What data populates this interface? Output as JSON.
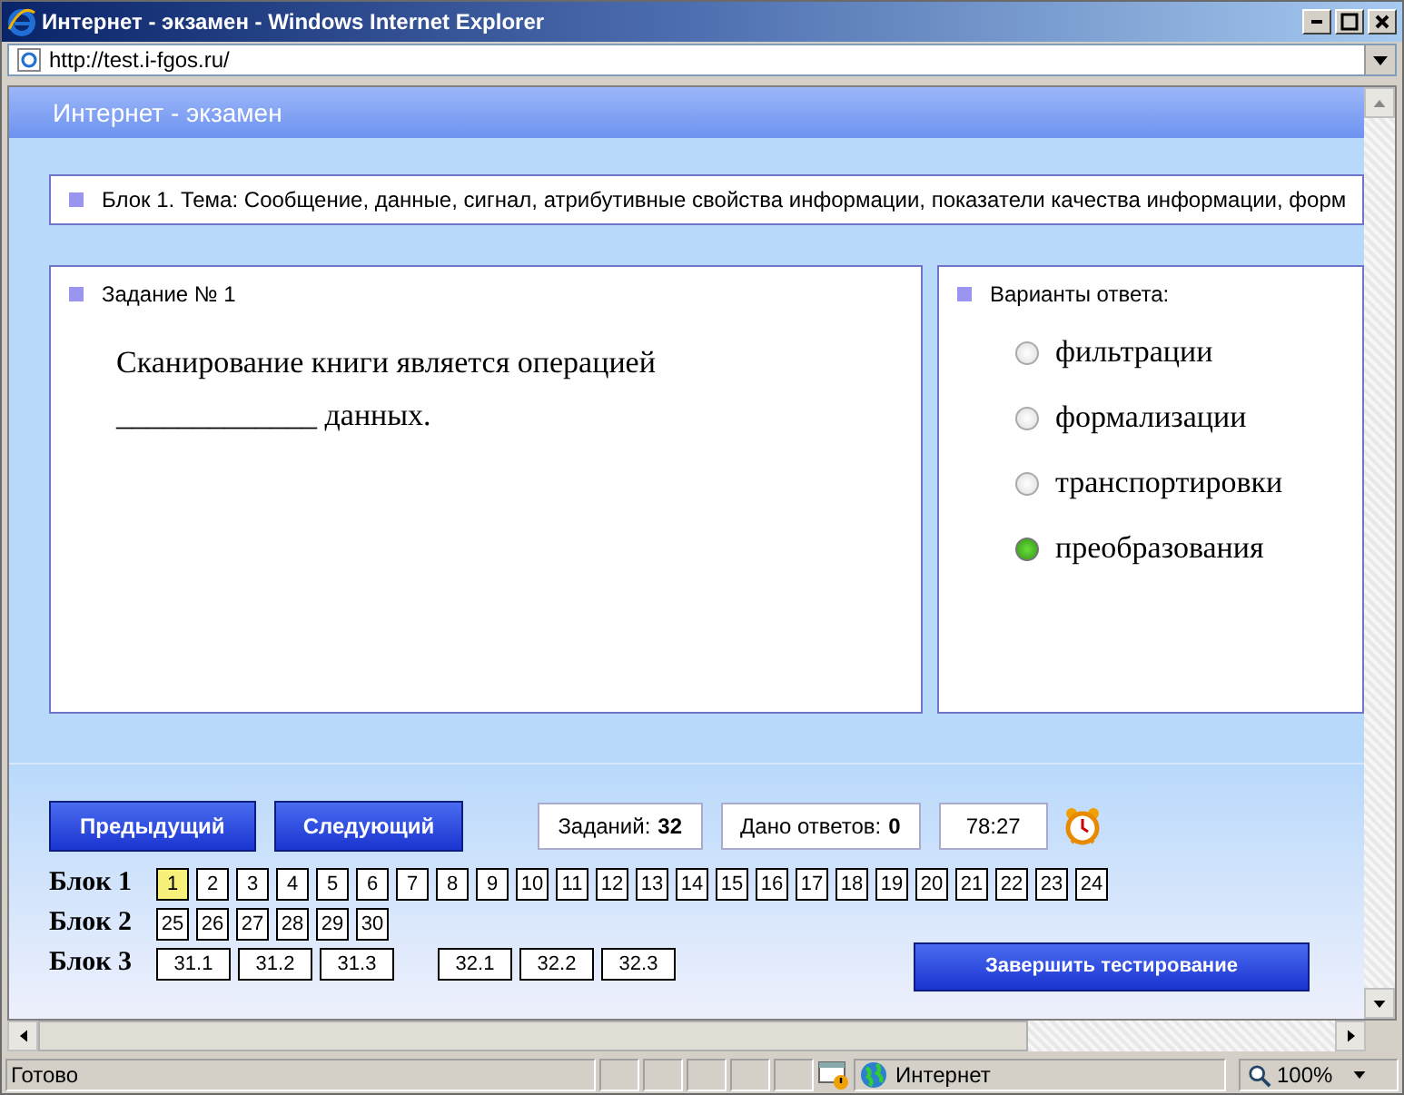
{
  "window": {
    "title": "Интернет - экзамен - Windows Internet Explorer"
  },
  "address_bar": {
    "value": "http://test.i-fgos.ru/"
  },
  "page": {
    "header": "Интернет - экзамен",
    "topic": "Блок 1. Тема: Сообщение, данные, сигнал, атрибутивные свойства информации, показатели качества информации, форм",
    "task": {
      "title": "Задание № 1",
      "question": "Сканирование книги является операцией _____________ данных."
    },
    "answers": {
      "title": "Варианты ответа:",
      "options": [
        {
          "label": "фильтрации",
          "selected": false
        },
        {
          "label": "формализации",
          "selected": false
        },
        {
          "label": "транспортировки",
          "selected": false
        },
        {
          "label": "преобразования",
          "selected": true
        }
      ]
    },
    "buttons": {
      "previous": "Предыдущий",
      "next": "Следующий",
      "finish": "Завершить тестирование"
    },
    "counters": [
      {
        "label": "Заданий:",
        "value": "32"
      },
      {
        "label": "Дано ответов:",
        "value": "0"
      }
    ],
    "timer": "78:27",
    "blocks": [
      {
        "label": "Блок 1",
        "groups": [
          [
            {
              "label": "1",
              "selected": true
            },
            {
              "label": "2",
              "selected": false
            },
            {
              "label": "3",
              "selected": false
            },
            {
              "label": "4",
              "selected": false
            },
            {
              "label": "5",
              "selected": false
            },
            {
              "label": "6",
              "selected": false
            },
            {
              "label": "7",
              "selected": false
            },
            {
              "label": "8",
              "selected": false
            },
            {
              "label": "9",
              "selected": false
            },
            {
              "label": "10",
              "selected": false
            },
            {
              "label": "11",
              "selected": false
            },
            {
              "label": "12",
              "selected": false
            },
            {
              "label": "13",
              "selected": false
            },
            {
              "label": "14",
              "selected": false
            },
            {
              "label": "15",
              "selected": false
            },
            {
              "label": "16",
              "selected": false
            },
            {
              "label": "17",
              "selected": false
            },
            {
              "label": "18",
              "selected": false
            },
            {
              "label": "19",
              "selected": false
            },
            {
              "label": "20",
              "selected": false
            },
            {
              "label": "21",
              "selected": false
            },
            {
              "label": "22",
              "selected": false
            },
            {
              "label": "23",
              "selected": false
            },
            {
              "label": "24",
              "selected": false
            }
          ]
        ]
      },
      {
        "label": "Блок 2",
        "groups": [
          [
            {
              "label": "25",
              "selected": false
            },
            {
              "label": "26",
              "selected": false
            },
            {
              "label": "27",
              "selected": false
            },
            {
              "label": "28",
              "selected": false
            },
            {
              "label": "29",
              "selected": false
            },
            {
              "label": "30",
              "selected": false
            }
          ]
        ]
      },
      {
        "label": "Блок 3",
        "groups": [
          [
            {
              "label": "31.1",
              "selected": false
            },
            {
              "label": "31.2",
              "selected": false
            },
            {
              "label": "31.3",
              "selected": false
            }
          ],
          [
            {
              "label": "32.1",
              "selected": false
            },
            {
              "label": "32.2",
              "selected": false
            },
            {
              "label": "32.3",
              "selected": false
            }
          ]
        ]
      }
    ]
  },
  "status_bar": {
    "status": "Готово",
    "zone": "Интернет",
    "zoom": "100%"
  }
}
